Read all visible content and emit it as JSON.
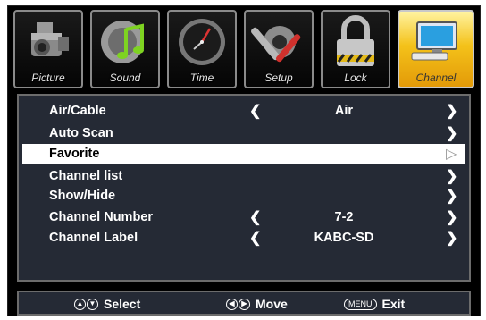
{
  "tabs": [
    {
      "label": "Picture",
      "icon": "camcorder-icon"
    },
    {
      "label": "Sound",
      "icon": "music-note-icon"
    },
    {
      "label": "Time",
      "icon": "clock-icon"
    },
    {
      "label": "Setup",
      "icon": "tools-icon"
    },
    {
      "label": "Lock",
      "icon": "padlock-icon"
    },
    {
      "label": "Channel",
      "icon": "monitor-icon",
      "active": true
    }
  ],
  "menu": {
    "items": [
      {
        "label": "Air/Cable",
        "value": "Air",
        "left_arrow": "❮",
        "right_arrow": "❯"
      },
      {
        "label": "Auto Scan",
        "value": "",
        "left_arrow": "",
        "right_arrow": "❯"
      },
      {
        "label": "Favorite",
        "value": "",
        "left_arrow": "",
        "right_arrow": "▷",
        "selected": true
      },
      {
        "label": "Channel list",
        "value": "",
        "left_arrow": "",
        "right_arrow": "❯"
      },
      {
        "label": "Show/Hide",
        "value": "",
        "left_arrow": "",
        "right_arrow": "❯"
      },
      {
        "label": "Channel Number",
        "value": "7-2",
        "left_arrow": "❮",
        "right_arrow": "❯"
      },
      {
        "label": "Channel Label",
        "value": "KABC-SD",
        "left_arrow": "❮",
        "right_arrow": "❯"
      }
    ]
  },
  "footer": {
    "select_label": "Select",
    "move_label": "Move",
    "menu_key": "MENU",
    "exit_label": "Exit"
  },
  "colors": {
    "panel_bg": "#252a35",
    "active_tab": "#f4c21a",
    "selected_row": "#ffffff"
  }
}
